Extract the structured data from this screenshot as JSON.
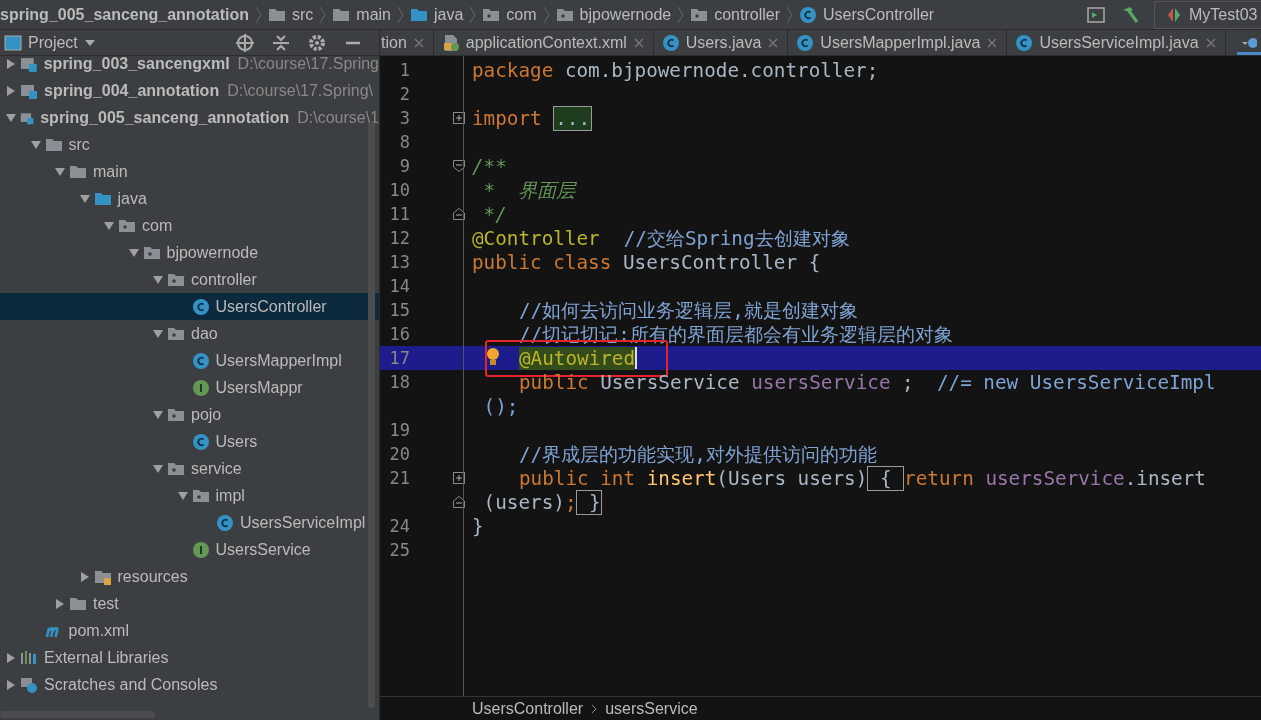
{
  "breadcrumb": [
    {
      "label": "spring_005_sanceng_annotation",
      "kind": "module"
    },
    {
      "label": "src",
      "kind": "folder"
    },
    {
      "label": "main",
      "kind": "folder"
    },
    {
      "label": "java",
      "kind": "source-folder"
    },
    {
      "label": "com",
      "kind": "package"
    },
    {
      "label": "bjpowernode",
      "kind": "package"
    },
    {
      "label": "controller",
      "kind": "package"
    },
    {
      "label": "UsersController",
      "kind": "class"
    }
  ],
  "run_config": {
    "label": "MyTest03"
  },
  "project_panel": {
    "title": "Project"
  },
  "tabs": [
    {
      "label": "tion",
      "kind": "none",
      "selected": false
    },
    {
      "label": "applicationContext.xml",
      "kind": "xml",
      "selected": false
    },
    {
      "label": "Users.java",
      "kind": "class",
      "selected": false
    },
    {
      "label": "UsersMapperImpl.java",
      "kind": "class",
      "selected": false
    },
    {
      "label": "UsersServiceImpl.java",
      "kind": "class",
      "selected": false
    }
  ],
  "tree": [
    {
      "name": "spring_003_sancengxml",
      "path": "D:\\course\\17.Spring",
      "kind": "module",
      "expanded": false,
      "selected": false
    },
    {
      "name": "spring_004_annotation",
      "path": "D:\\course\\17.Spring\\",
      "kind": "module",
      "expanded": false,
      "selected": false
    },
    {
      "name": "spring_005_sanceng_annotation",
      "path": "D:\\course\\1",
      "kind": "module",
      "expanded": true,
      "selected": false,
      "children": [
        {
          "name": "src",
          "kind": "folder",
          "expanded": true,
          "selected": false,
          "children": [
            {
              "name": "main",
              "kind": "folder",
              "expanded": true,
              "selected": false,
              "children": [
                {
                  "name": "java",
                  "kind": "source-folder",
                  "expanded": true,
                  "selected": false,
                  "children": [
                    {
                      "name": "com",
                      "kind": "package",
                      "expanded": true,
                      "selected": false,
                      "children": [
                        {
                          "name": "bjpowernode",
                          "kind": "package",
                          "expanded": true,
                          "selected": false,
                          "children": [
                            {
                              "name": "controller",
                              "kind": "package",
                              "expanded": true,
                              "selected": false,
                              "children": [
                                {
                                  "name": "UsersController",
                                  "kind": "class",
                                  "selected": true
                                }
                              ]
                            },
                            {
                              "name": "dao",
                              "kind": "package",
                              "expanded": true,
                              "selected": false,
                              "children": [
                                {
                                  "name": "UsersMapperImpl",
                                  "kind": "class",
                                  "selected": false
                                },
                                {
                                  "name": "UsersMappr",
                                  "kind": "interface",
                                  "selected": false
                                }
                              ]
                            },
                            {
                              "name": "pojo",
                              "kind": "package",
                              "expanded": true,
                              "selected": false,
                              "children": [
                                {
                                  "name": "Users",
                                  "kind": "class",
                                  "selected": false
                                }
                              ]
                            },
                            {
                              "name": "service",
                              "kind": "package",
                              "expanded": true,
                              "selected": false,
                              "children": [
                                {
                                  "name": "impl",
                                  "kind": "package",
                                  "expanded": true,
                                  "selected": false,
                                  "children": [
                                    {
                                      "name": "UsersServiceImpl",
                                      "kind": "class",
                                      "selected": false
                                    }
                                  ]
                                },
                                {
                                  "name": "UsersService",
                                  "kind": "interface",
                                  "selected": false
                                }
                              ]
                            }
                          ]
                        }
                      ]
                    }
                  ]
                },
                {
                  "name": "resources",
                  "kind": "resources",
                  "expanded": false,
                  "selected": false
                }
              ]
            },
            {
              "name": "test",
              "kind": "folder",
              "expanded": false,
              "selected": false
            }
          ]
        },
        {
          "name": "pom.xml",
          "kind": "maven",
          "selected": false
        }
      ]
    },
    {
      "name": "External Libraries",
      "kind": "libraries",
      "expanded": false,
      "selected": false
    },
    {
      "name": "Scratches and Consoles",
      "kind": "scratches",
      "expanded": false,
      "selected": false
    }
  ],
  "editor_rows": [
    {
      "number": "1",
      "segments": [
        {
          "kind": "keyword",
          "text": "package "
        },
        {
          "kind": "plain",
          "text": "com.bjpowernode.controller;"
        }
      ]
    },
    {
      "number": "2"
    },
    {
      "number": "3",
      "fold": {
        "kind": "expand"
      },
      "segments": [
        {
          "kind": "keyword",
          "text": "import "
        },
        {
          "kind": "folded",
          "text": "..."
        }
      ]
    },
    {
      "number": "8"
    },
    {
      "number": "9",
      "fold": {
        "kind": "collapse-start"
      },
      "segments": [
        {
          "kind": "doc",
          "text": "/**"
        }
      ]
    },
    {
      "number": "10",
      "segments": [
        {
          "kind": "doc",
          "text": " *  界面层"
        }
      ]
    },
    {
      "number": "11",
      "fold": {
        "kind": "collapse-end"
      },
      "segments": [
        {
          "kind": "doc",
          "text": " */"
        }
      ]
    },
    {
      "number": "12",
      "segments": [
        {
          "kind": "annotation",
          "text": "@Controller"
        },
        {
          "kind": "comment",
          "text": "//交给Spring去创建对象",
          "gap": true
        }
      ]
    },
    {
      "number": "13",
      "segments": [
        {
          "kind": "keyword",
          "text": "public class "
        },
        {
          "kind": "plain",
          "text": "UsersController {"
        }
      ]
    },
    {
      "number": "14"
    },
    {
      "number": "15",
      "indented": true,
      "segments": [
        {
          "kind": "comment",
          "text": "//如何去访问业务逻辑层,就是创建对象"
        }
      ]
    },
    {
      "number": "16",
      "indented": true,
      "segments": [
        {
          "kind": "comment",
          "text": "//切记切记:所有的界面层都会有业务逻辑层的对象"
        }
      ]
    },
    {
      "number": "17",
      "indented": true,
      "current": true,
      "bulb": true,
      "marked": true,
      "segments": [
        {
          "kind": "annotation",
          "text": "@Autowired",
          "highlighted": true
        }
      ]
    },
    {
      "number": "18",
      "indented": true,
      "segments": [
        {
          "kind": "keyword",
          "text": "public "
        },
        {
          "kind": "plain",
          "text": "UsersService "
        },
        {
          "kind": "field",
          "text": "usersService"
        },
        {
          "kind": "plain",
          "text": " ;  "
        },
        {
          "kind": "comment",
          "text": "//= new UsersServiceImpl"
        }
      ]
    },
    {
      "segments": [
        {
          "kind": "comment",
          "text": " ();"
        }
      ]
    },
    {
      "number": "19"
    },
    {
      "number": "20",
      "indented": true,
      "segments": [
        {
          "kind": "comment",
          "text": "//界成层的功能实现,对外提供访问的功能"
        }
      ]
    },
    {
      "number": "21",
      "indented": true,
      "fold": {
        "kind": "expand"
      },
      "segments": [
        {
          "kind": "keyword",
          "text": "public int "
        },
        {
          "kind": "method",
          "text": "insert"
        },
        {
          "kind": "plain",
          "text": "(Users users)"
        },
        {
          "kind": "brace",
          "text": " { "
        },
        {
          "kind": "keyword",
          "text": "return "
        },
        {
          "kind": "field",
          "text": "usersService"
        },
        {
          "kind": "plain",
          "text": ".insert"
        }
      ]
    },
    {
      "fold": {
        "kind": "collapse-end"
      },
      "segments": [
        {
          "kind": "plain",
          "text": " (users)"
        },
        {
          "kind": "keyword",
          "text": ";"
        },
        {
          "kind": "brace",
          "text": " }"
        }
      ]
    },
    {
      "number": "24",
      "segments": [
        {
          "kind": "plain",
          "text": "}"
        }
      ]
    },
    {
      "number": "25"
    }
  ],
  "status_breadcrumb": [
    "UsersController",
    "usersService"
  ]
}
